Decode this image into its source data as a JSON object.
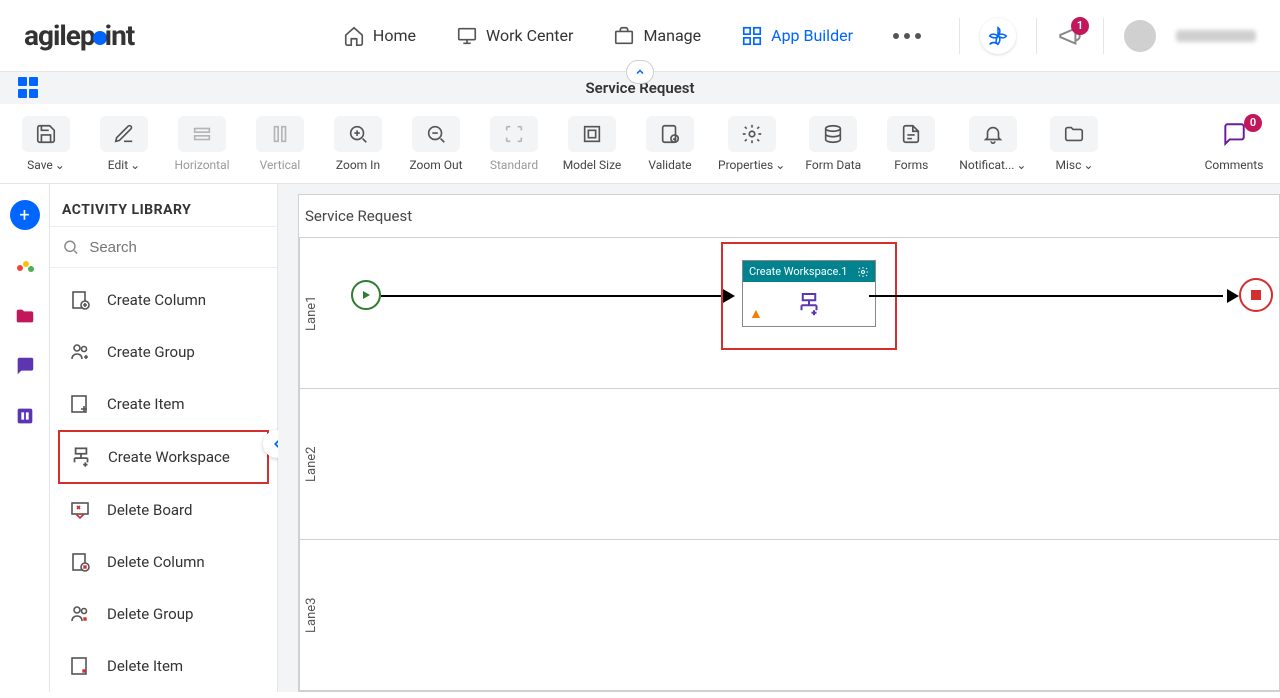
{
  "header": {
    "nav": {
      "home": "Home",
      "work_center": "Work Center",
      "manage": "Manage",
      "app_builder": "App Builder"
    },
    "notification_badge": "1",
    "comments_badge": "0"
  },
  "subheader": {
    "title": "Service Request"
  },
  "toolbar": {
    "save": "Save",
    "edit": "Edit",
    "horizontal": "Horizontal",
    "vertical": "Vertical",
    "zoom_in": "Zoom In",
    "zoom_out": "Zoom Out",
    "standard": "Standard",
    "model_size": "Model Size",
    "validate": "Validate",
    "properties": "Properties",
    "form_data": "Form Data",
    "forms": "Forms",
    "notifications": "Notificat...",
    "misc": "Misc",
    "comments": "Comments"
  },
  "library": {
    "title": "ACTIVITY LIBRARY",
    "search_placeholder": "Search",
    "items": [
      "Create Column",
      "Create Group",
      "Create Item",
      "Create Workspace",
      "Delete Board",
      "Delete Column",
      "Delete Group",
      "Delete Item"
    ]
  },
  "canvas": {
    "title": "Service Request",
    "lanes": [
      "Lane1",
      "Lane2",
      "Lane3"
    ],
    "activity": {
      "name": "Create Workspace.1"
    }
  }
}
